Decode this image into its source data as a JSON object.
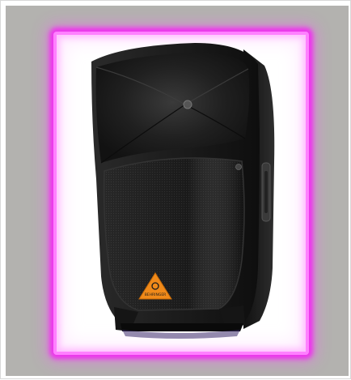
{
  "image": {
    "subject": "speaker",
    "logo_text": "BEHRINGER",
    "colors": {
      "backdrop": "#b3b2af",
      "glow": "#ff40ff",
      "panel": "#ffffff",
      "cabinet": "#1c1c1c",
      "logo_badge": "#f08a1a"
    }
  }
}
